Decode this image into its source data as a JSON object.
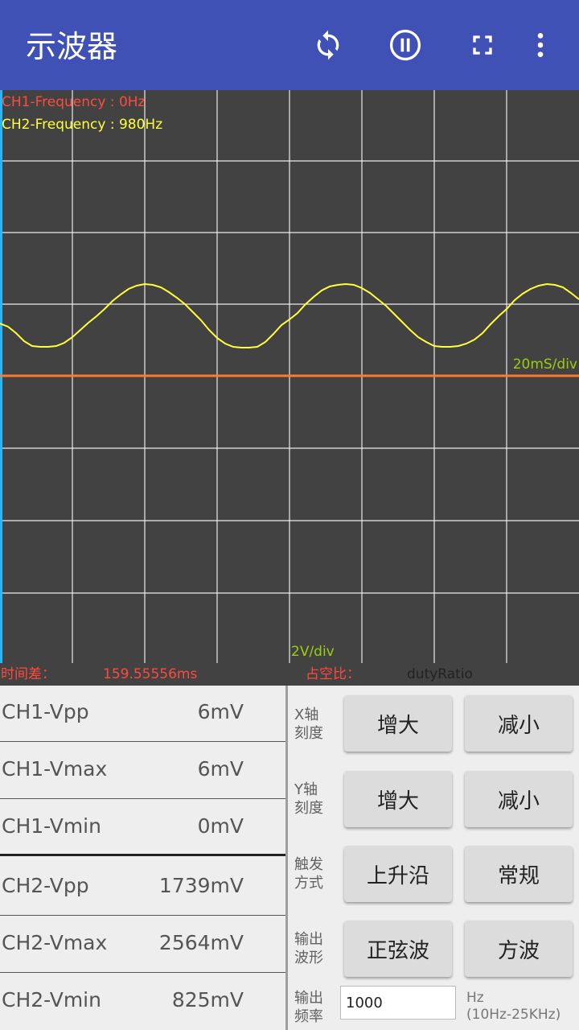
{
  "appbar": {
    "title": "示波器",
    "icons": [
      "refresh-icon",
      "pause-icon",
      "fullscreen-icon",
      "more-vert-icon"
    ]
  },
  "scope": {
    "ch1_frequency": "CH1-Frequency : 0Hz",
    "ch2_frequency": "CH2-Frequency : 980Hz",
    "x_scale": "20mS/div",
    "y_scale": "2V/div",
    "colors": {
      "background": "#424242",
      "grid": "#ffffff",
      "ch1": "#ff7a2f",
      "ch2": "#ffff3b",
      "scale": "#9ccc12"
    }
  },
  "measure": {
    "time_diff_label": "时间差：",
    "time_diff_value": "159.55556ms",
    "duty_label": "占空比：",
    "duty_value": "dutyRatio"
  },
  "stats": [
    {
      "label": "CH1-Vpp",
      "value": "6mV"
    },
    {
      "label": "CH1-Vmax",
      "value": "6mV"
    },
    {
      "label": "CH1-Vmin",
      "value": "0mV"
    },
    {
      "label": "CH2-Vpp",
      "value": "1739mV"
    },
    {
      "label": "CH2-Vmax",
      "value": "2564mV"
    },
    {
      "label": "CH2-Vmin",
      "value": "825mV"
    }
  ],
  "controls": {
    "x_axis": {
      "label": "X轴\n刻度",
      "increase": "增大",
      "decrease": "减小"
    },
    "y_axis": {
      "label": "Y轴\n刻度",
      "increase": "增大",
      "decrease": "减小"
    },
    "trigger": {
      "label": "触发\n方式",
      "rising": "上升沿",
      "normal": "常规"
    },
    "waveform": {
      "label": "输出\n波形",
      "sine": "正弦波",
      "square": "方波"
    },
    "frequency": {
      "label": "输出\n频率",
      "value": "1000",
      "unit": "Hz\n(10Hz-25KHz)"
    }
  }
}
